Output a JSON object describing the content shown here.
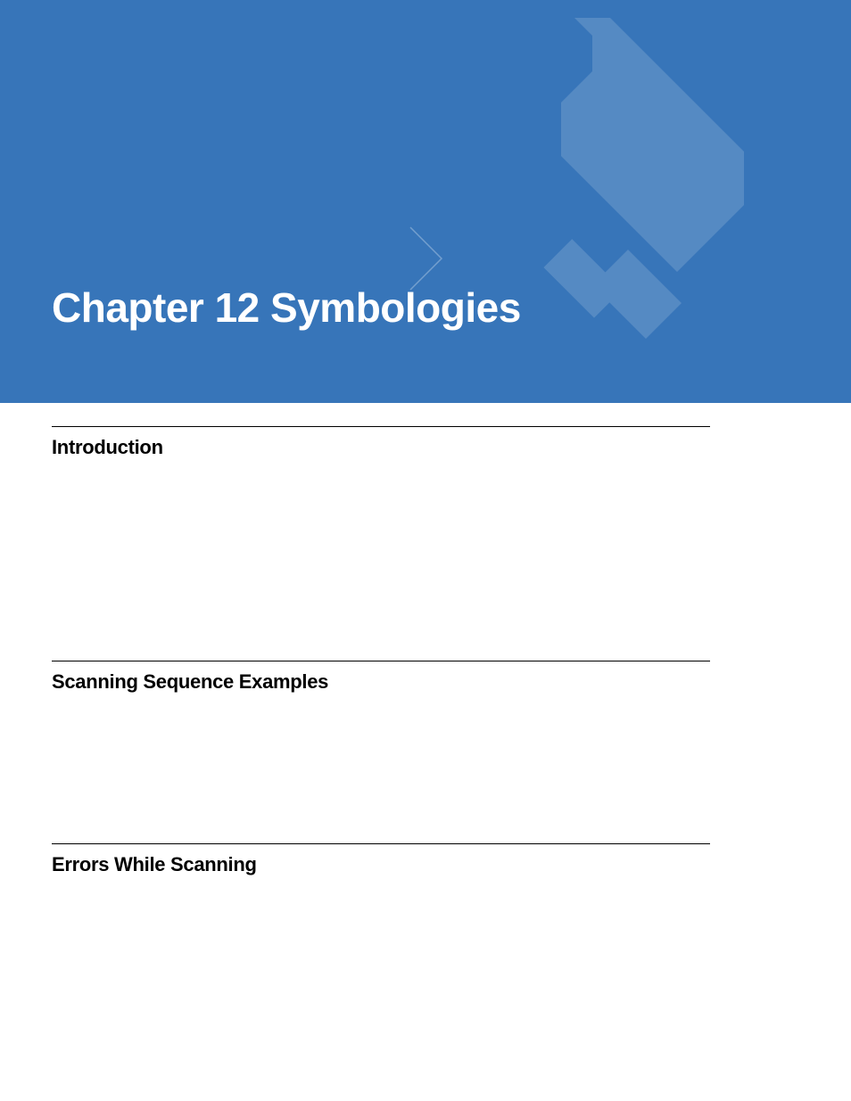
{
  "banner": {
    "title": "Chapter 12  Symbologies"
  },
  "sections": {
    "intro": {
      "heading": "Introduction"
    },
    "seq": {
      "heading": "Scanning Sequence Examples"
    },
    "err": {
      "heading": "Errors While Scanning"
    }
  }
}
